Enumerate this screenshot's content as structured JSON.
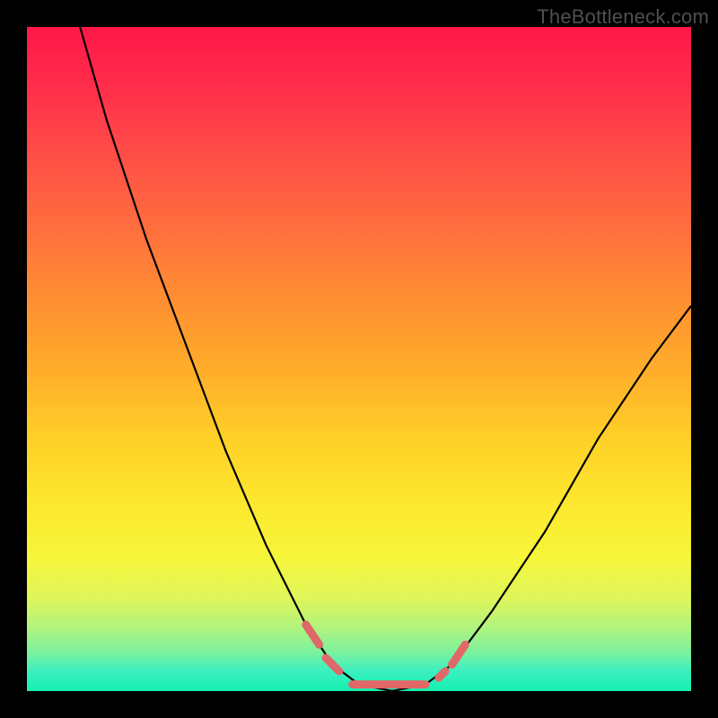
{
  "watermark": "TheBottleneck.com",
  "chart_data": {
    "type": "line",
    "title": "",
    "xlabel": "",
    "ylabel": "",
    "xlim": [
      0,
      100
    ],
    "ylim": [
      0,
      100
    ],
    "grid": false,
    "legend": false,
    "series": [
      {
        "name": "bottleneck-curve",
        "style": "solid-black",
        "points": [
          {
            "x": 8,
            "y": 100
          },
          {
            "x": 12,
            "y": 86
          },
          {
            "x": 18,
            "y": 68
          },
          {
            "x": 24,
            "y": 52
          },
          {
            "x": 30,
            "y": 36
          },
          {
            "x": 36,
            "y": 22
          },
          {
            "x": 42,
            "y": 10
          },
          {
            "x": 46,
            "y": 4
          },
          {
            "x": 50,
            "y": 1
          },
          {
            "x": 55,
            "y": 0
          },
          {
            "x": 60,
            "y": 1
          },
          {
            "x": 64,
            "y": 4
          },
          {
            "x": 70,
            "y": 12
          },
          {
            "x": 78,
            "y": 24
          },
          {
            "x": 86,
            "y": 38
          },
          {
            "x": 94,
            "y": 50
          },
          {
            "x": 100,
            "y": 58
          }
        ]
      },
      {
        "name": "highlight-segments",
        "style": "coral-thick",
        "segments": [
          [
            {
              "x": 42,
              "y": 10
            },
            {
              "x": 44,
              "y": 7
            }
          ],
          [
            {
              "x": 45,
              "y": 5
            },
            {
              "x": 47,
              "y": 3
            }
          ],
          [
            {
              "x": 49,
              "y": 1
            },
            {
              "x": 60,
              "y": 1
            }
          ],
          [
            {
              "x": 62,
              "y": 2
            },
            {
              "x": 63,
              "y": 3
            }
          ],
          [
            {
              "x": 64,
              "y": 4
            },
            {
              "x": 66,
              "y": 7
            }
          ]
        ]
      }
    ],
    "background_gradient": {
      "top": "#ff1848",
      "mid_upper": "#ffae2a",
      "mid_lower": "#fce82e",
      "bottom": "#15f0b0"
    }
  }
}
